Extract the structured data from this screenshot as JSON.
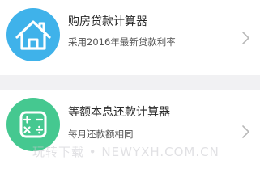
{
  "items": [
    {
      "title": "购房贷款计算器",
      "subtitle": "采用2016年最新贷款利率",
      "icon": "house-icon",
      "icon_color": "#3fb2ea"
    },
    {
      "title": "等额本息还款计算器",
      "subtitle": "每月还款额相同",
      "icon": "calculator-icon",
      "icon_color": "#45c890"
    }
  ],
  "watermark": "玩转下载 • NEWYXH.COM.CN"
}
